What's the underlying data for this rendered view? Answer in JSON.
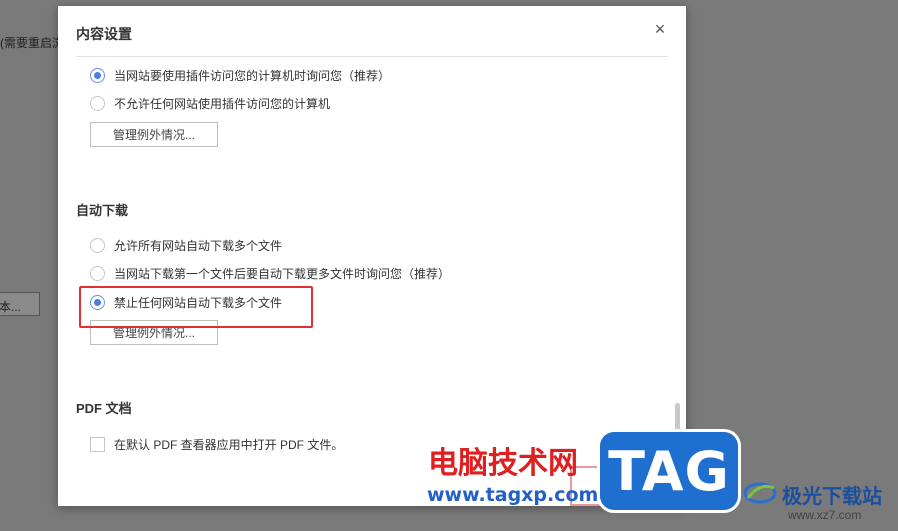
{
  "background": {
    "partial_label": "(需要重启浏",
    "partial_button": "本..."
  },
  "dialog": {
    "title": "内容设置",
    "close_glyph": "×",
    "plugins": {
      "options": [
        {
          "label": "当网站要使用插件访问您的计算机时询问您（推荐）",
          "checked": true
        },
        {
          "label": "不允许任何网站使用插件访问您的计算机",
          "checked": false
        }
      ],
      "manage_label": "管理例外情况..."
    },
    "auto_download": {
      "heading": "自动下载",
      "options": [
        {
          "label": "允许所有网站自动下载多个文件",
          "checked": false
        },
        {
          "label": "当网站下载第一个文件后要自动下载更多文件时询问您（推荐）",
          "checked": false
        },
        {
          "label": "禁止任何网站自动下载多个文件",
          "checked": true
        }
      ],
      "manage_label": "管理例外情况..."
    },
    "pdf": {
      "heading": "PDF 文档",
      "checkbox_label": "在默认 PDF 查看器应用中打开 PDF 文件。",
      "checked": false
    }
  },
  "watermarks": {
    "site_name": "电脑技术网",
    "site_url": "www.tagxp.com",
    "tag_logo": "TAG",
    "brand_name": "极光下载站",
    "brand_url": "www.xz7.com"
  },
  "colors": {
    "accent": "#4a7ee0",
    "highlight": "#e23030",
    "overlay": "#7a7a7a"
  }
}
